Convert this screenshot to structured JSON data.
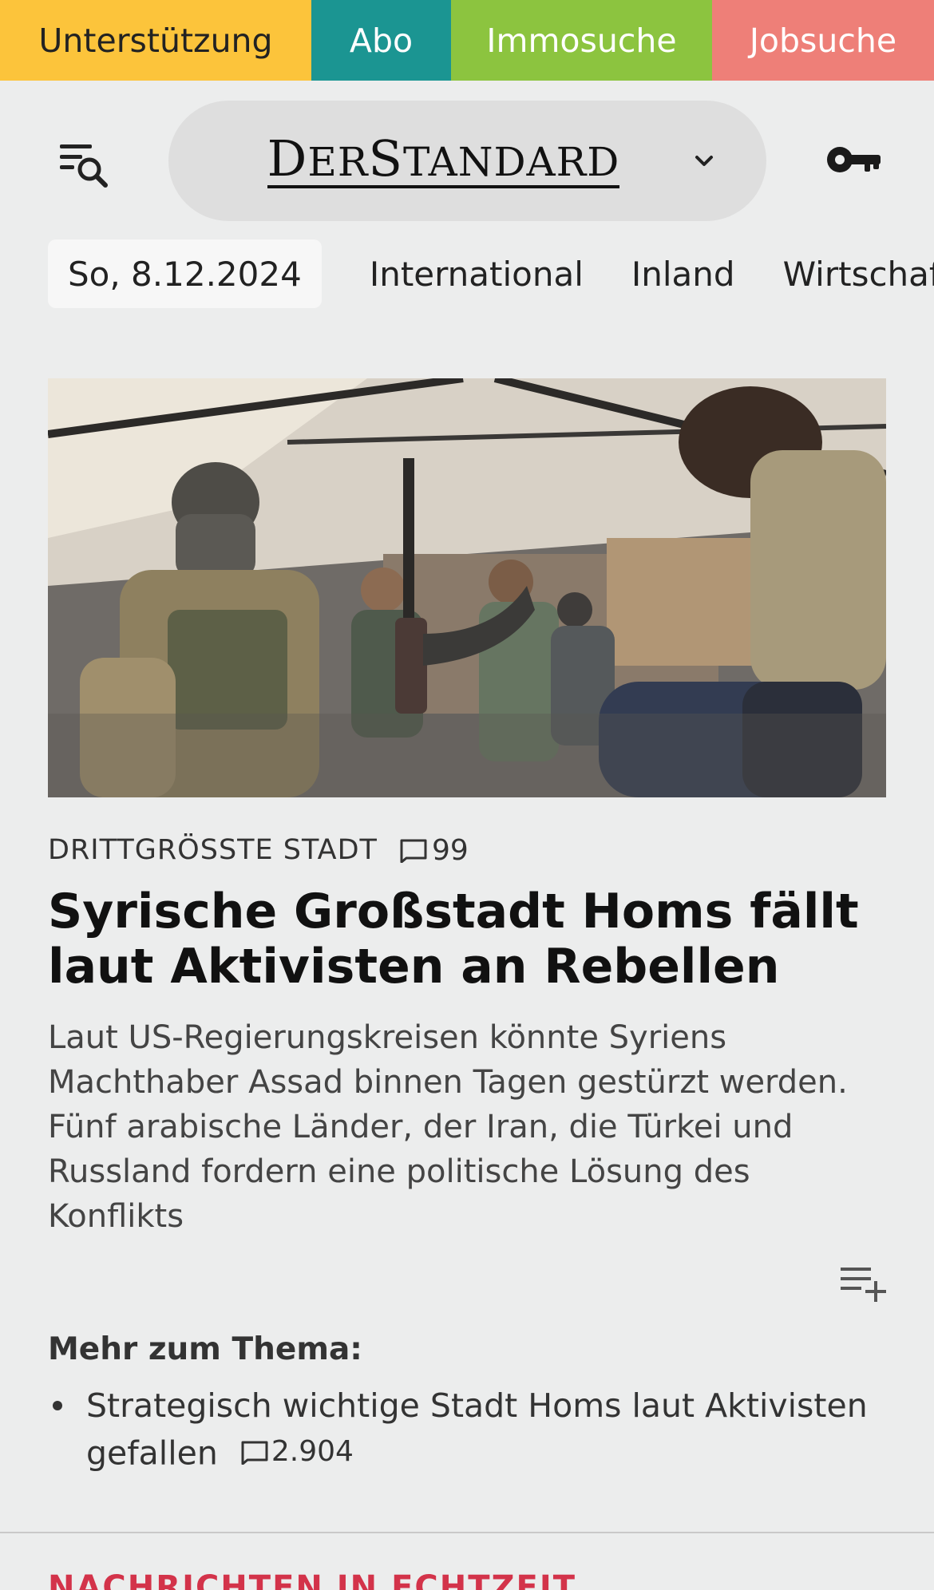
{
  "topbar": {
    "support_label": "Unterstützung",
    "abo_label": "Abo",
    "immo_label": "Immosuche",
    "job_label": "Jobsuche",
    "colors": {
      "support": "#fcc43b",
      "abo": "#1b9592",
      "immo": "#8cc43f",
      "job": "#ee7f78"
    }
  },
  "header": {
    "logo_text": "DERSTANDARD",
    "menu_icon": "menu-search-icon",
    "dropdown_icon": "chevron-down-icon",
    "login_icon": "key-icon"
  },
  "nav": {
    "date": "So, 8.12.2024",
    "items": [
      "International",
      "Inland",
      "Wirtschaft"
    ]
  },
  "article": {
    "kicker": "DRITTGRÖSSTE STADT",
    "comment_count": "99",
    "headline": "Syrische Großstadt Homs fällt laut Aktivisten an Rebellen",
    "lead": "Laut US-Regierungskreisen könnte Syriens Machthaber Assad binnen Tagen gestürzt werden. Fünf arabische Länder, der Iran, die Türkei und Russland fordern eine politische Lösung des Konflikts",
    "playlist_icon": "playlist-add-icon"
  },
  "more": {
    "title": "Mehr zum Thema:",
    "items": [
      {
        "text": "Strategisch wichtige Stadt Homs laut Aktivisten gefallen",
        "comments": "2.904"
      }
    ]
  },
  "next_section": {
    "title": "NACHRICHTEN IN ECHTZEIT",
    "color": "#d3334a"
  }
}
